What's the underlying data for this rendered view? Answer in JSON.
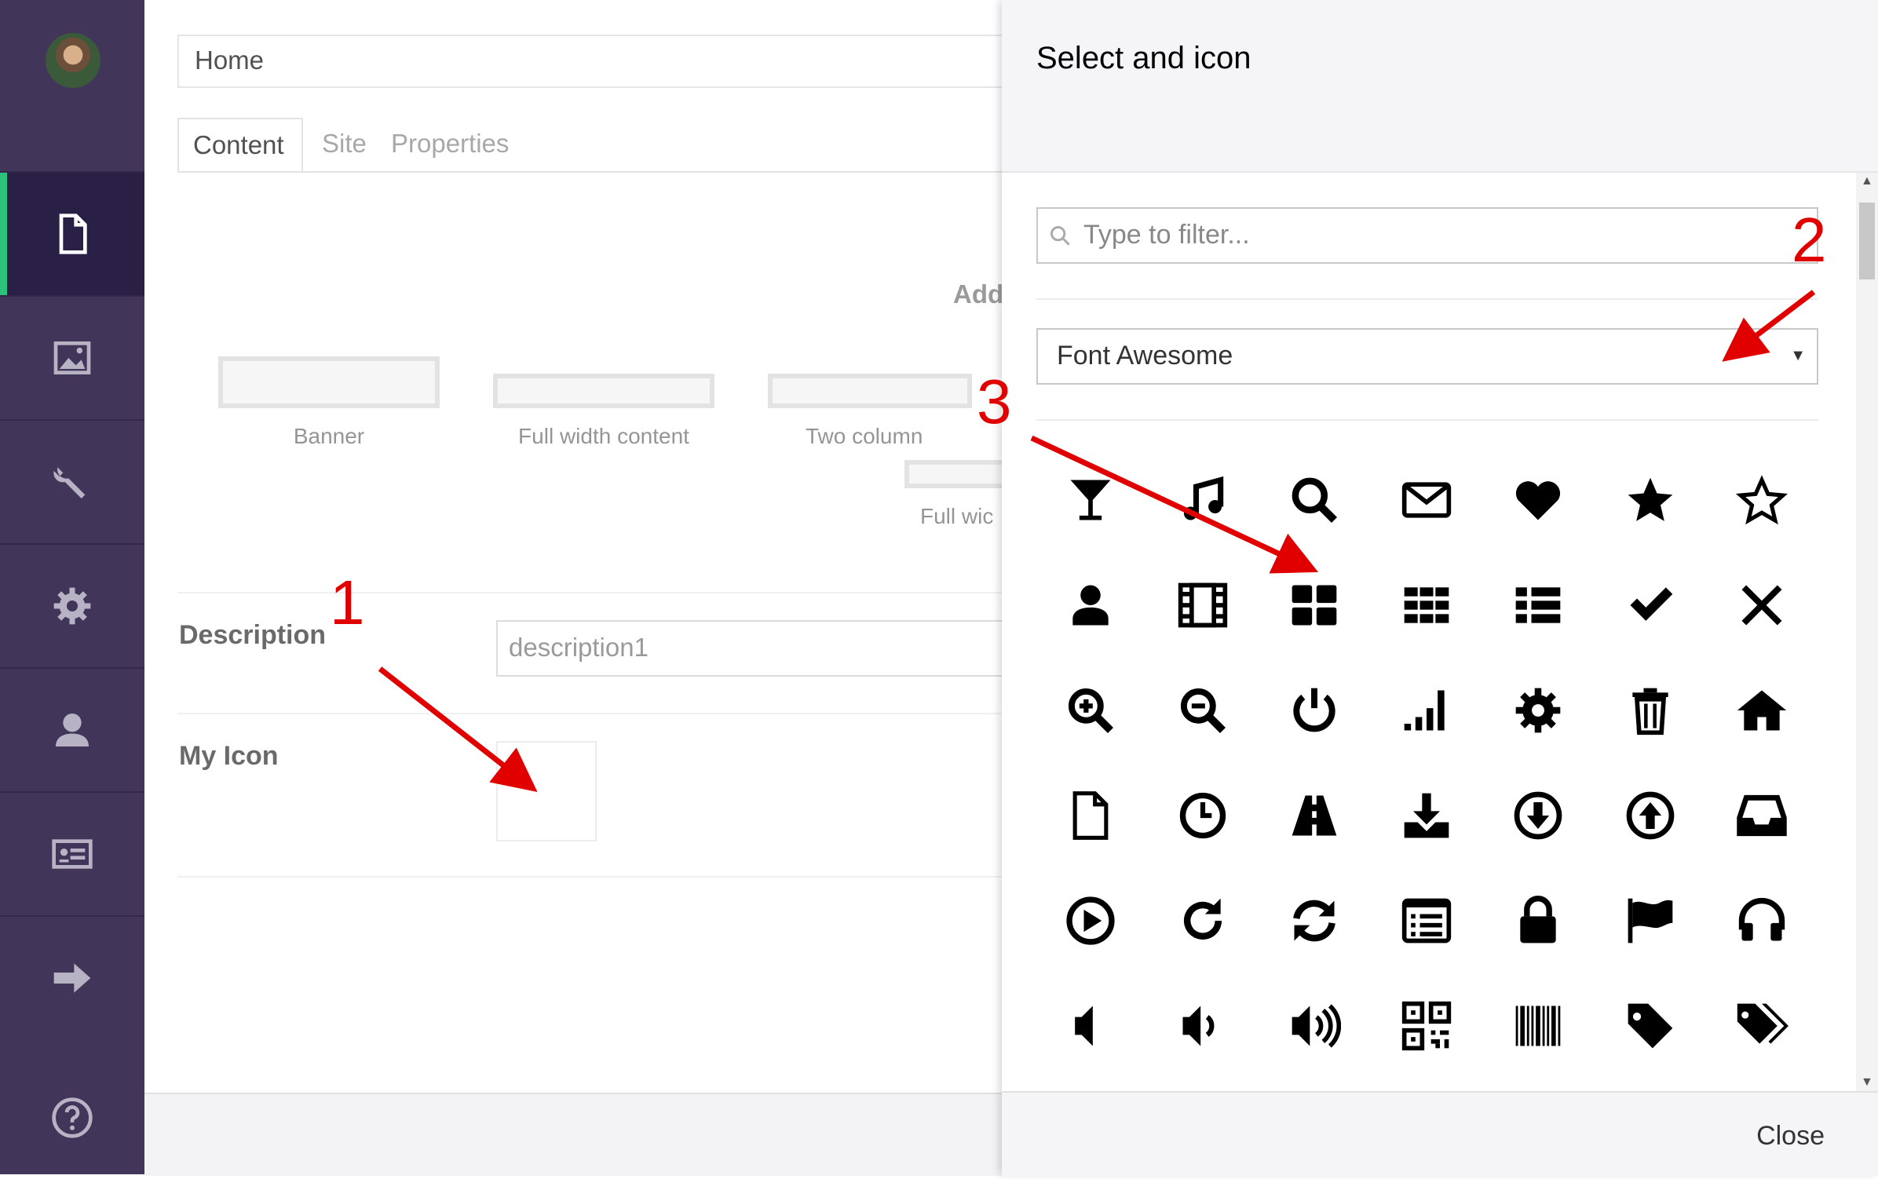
{
  "editor": {
    "name_value": "Home",
    "tabs": [
      {
        "label": "Content"
      },
      {
        "label": "Site"
      },
      {
        "label": "Properties"
      }
    ],
    "add_label": "Add",
    "layouts": [
      {
        "label": "Banner"
      },
      {
        "label": "Full width content"
      },
      {
        "label": "Two column"
      },
      {
        "label": "Full wic"
      }
    ],
    "properties": {
      "description_label": "Description",
      "description_value": "description1",
      "icon_label": "My Icon"
    }
  },
  "sidebar": {
    "items": [
      {
        "icon": "document-icon"
      },
      {
        "icon": "image-icon"
      },
      {
        "icon": "wrench-icon"
      },
      {
        "icon": "gear-icon"
      },
      {
        "icon": "user-icon"
      },
      {
        "icon": "id-card-icon"
      },
      {
        "icon": "arrow-right-icon"
      },
      {
        "icon": "help-icon"
      }
    ]
  },
  "dialog": {
    "title": "Select and icon",
    "filter_placeholder": "Type to filter...",
    "icon_set": "Font Awesome",
    "close_label": "Close",
    "icons": [
      "glass-icon",
      "music-icon",
      "search-icon",
      "envelope-icon",
      "heart-icon",
      "star-icon",
      "star-outline-icon",
      "user-icon",
      "film-icon",
      "th-large-icon",
      "th-icon",
      "th-list-icon",
      "check-icon",
      "times-icon",
      "zoom-in-icon",
      "zoom-out-icon",
      "power-off-icon",
      "signal-icon",
      "cog-icon",
      "trash-icon",
      "home-icon",
      "file-icon",
      "clock-icon",
      "road-icon",
      "download-icon",
      "arrow-circle-down-icon",
      "arrow-circle-up-icon",
      "inbox-icon",
      "play-circle-icon",
      "repeat-icon",
      "refresh-icon",
      "list-alt-icon",
      "lock-icon",
      "flag-icon",
      "headphones-icon",
      "volume-off-icon",
      "volume-down-icon",
      "volume-up-icon",
      "qrcode-icon",
      "barcode-icon",
      "tag-icon",
      "tags-icon"
    ]
  },
  "annotations": {
    "n1": "1",
    "n2": "2",
    "n3": "3",
    "color": "#e00000"
  },
  "colors": {
    "sidebar_bg": "#413659",
    "sidebar_active": "#2a1f44",
    "accent": "#2bc37c"
  }
}
